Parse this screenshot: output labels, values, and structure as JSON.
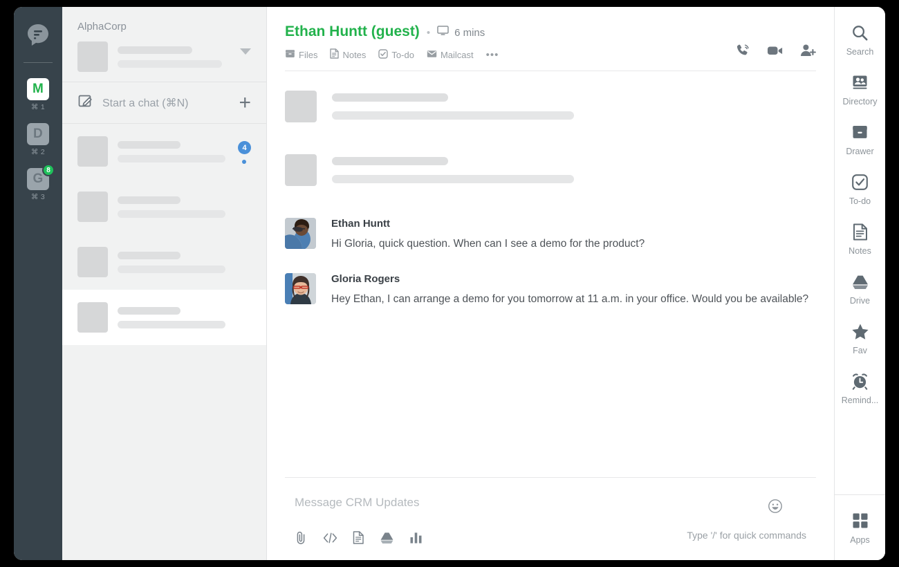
{
  "rail": {
    "logo_icon": "fleep-logo-icon",
    "workspaces": [
      {
        "letter": "M",
        "shortcut": "⌘ 1",
        "active": true,
        "badge": null
      },
      {
        "letter": "D",
        "shortcut": "⌘ 2",
        "active": false,
        "badge": null
      },
      {
        "letter": "G",
        "shortcut": "⌘ 3",
        "active": false,
        "badge": "8"
      }
    ],
    "badge_color": "#1fc15b",
    "background": "#37434b"
  },
  "sidebar": {
    "workspace_name": "AlphaCorp",
    "caret_icon": "chevron-down-icon",
    "start_chat_label": "Start a chat (⌘N)",
    "compose_icon": "compose-icon",
    "add_icon": "plus-icon",
    "chats": [
      {
        "unread_count": "4",
        "has_dot": true,
        "selected": false
      },
      {
        "unread_count": null,
        "has_dot": false,
        "selected": false
      },
      {
        "unread_count": null,
        "has_dot": false,
        "selected": false
      },
      {
        "unread_count": null,
        "has_dot": false,
        "selected": true
      }
    ],
    "unread_badge_color": "#4a90d9"
  },
  "header": {
    "title": "Ethan Huntt (guest)",
    "title_color": "#22b24c",
    "separator_dot": "•",
    "device_icon": "monitor-icon",
    "last_seen": "6 mins",
    "subnav": [
      {
        "label": "Files",
        "icon": "drawer-icon"
      },
      {
        "label": "Notes",
        "icon": "notes-icon"
      },
      {
        "label": "To-do",
        "icon": "checkbox-icon"
      },
      {
        "label": "Mailcast",
        "icon": "envelope-icon"
      }
    ],
    "overflow_label": "•••",
    "actions": [
      {
        "icon": "phone-call-icon"
      },
      {
        "icon": "video-camera-icon"
      },
      {
        "icon": "add-person-icon"
      }
    ]
  },
  "conversation": {
    "skeleton_messages": 2,
    "messages": [
      {
        "author": "Ethan Huntt",
        "avatar": "ethan-avatar",
        "text": "Hi Gloria, quick question. When can I see a demo for the product?"
      },
      {
        "author": "Gloria Rogers",
        "avatar": "gloria-avatar",
        "text": "Hey Ethan, I can arrange a demo for you tomorrow at 11 a.m. in your office. Would you be available?"
      }
    ]
  },
  "composer": {
    "placeholder": "Message CRM Updates",
    "hint": "Type '/' for quick commands",
    "emoji_icon": "smiley-icon",
    "tools": [
      {
        "icon": "paperclip-icon"
      },
      {
        "icon": "code-icon"
      },
      {
        "icon": "document-icon"
      },
      {
        "icon": "drive-icon"
      },
      {
        "icon": "poll-icon"
      }
    ]
  },
  "right_rail": {
    "items": [
      {
        "label": "Search",
        "icon": "search-icon"
      },
      {
        "label": "Directory",
        "icon": "directory-icon"
      },
      {
        "label": "Drawer",
        "icon": "drawer-icon"
      },
      {
        "label": "To-do",
        "icon": "checkbox-icon"
      },
      {
        "label": "Notes",
        "icon": "notes-icon"
      },
      {
        "label": "Drive",
        "icon": "drive-icon"
      },
      {
        "label": "Fav",
        "icon": "star-icon"
      },
      {
        "label": "Remind...",
        "icon": "alarm-clock-icon"
      }
    ],
    "bottom": {
      "label": "Apps",
      "icon": "grid-apps-icon"
    }
  }
}
